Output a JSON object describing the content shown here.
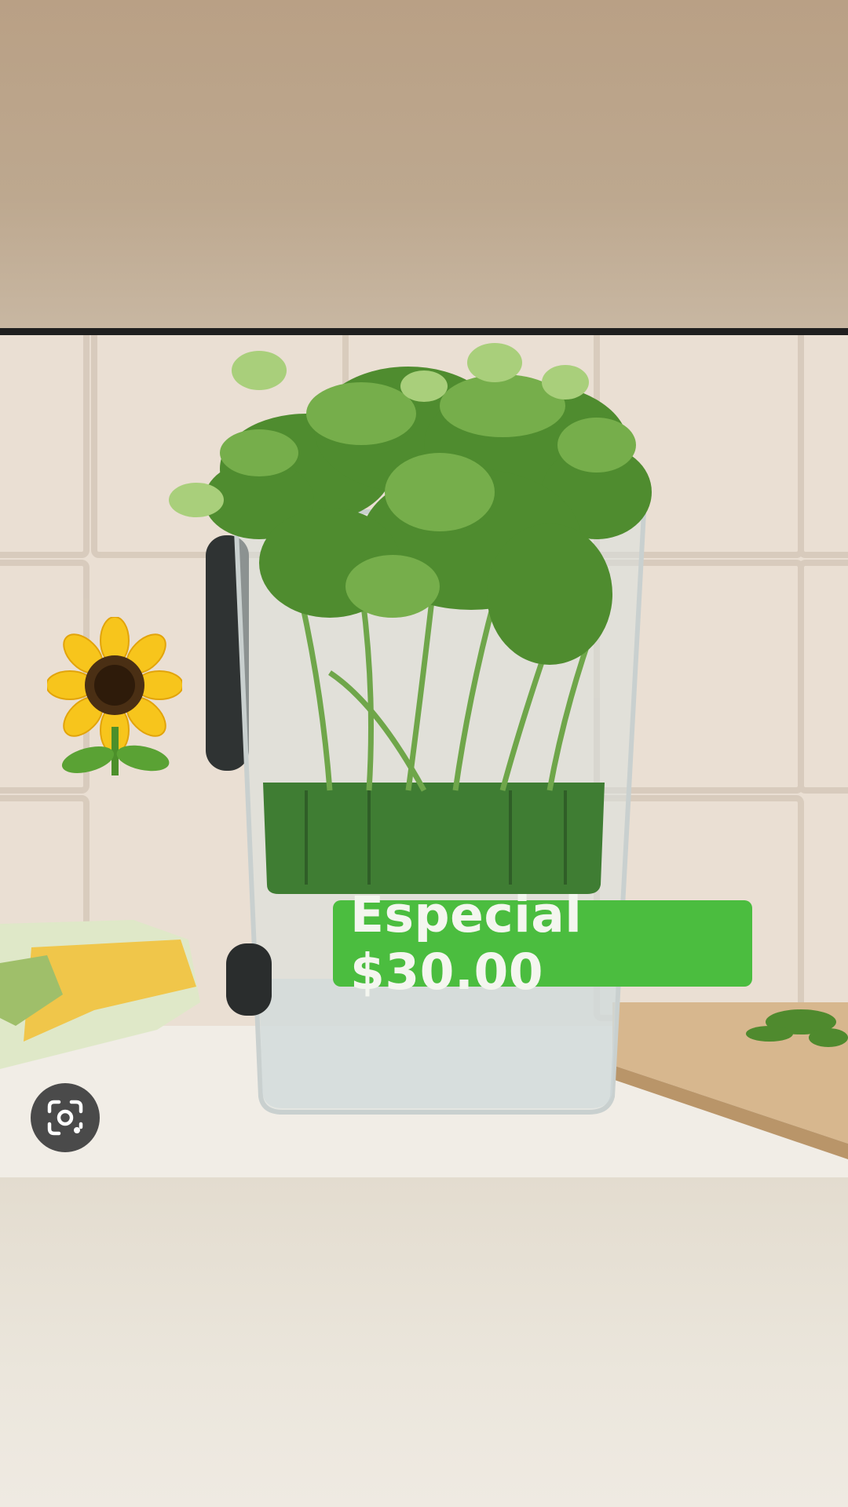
{
  "price_tag": {
    "text": "Especial $30.00"
  },
  "icons": {
    "lens": "google-lens-icon",
    "sticker": "sunflower-icon"
  },
  "colors": {
    "top_band": "#bda88f",
    "divider": "#1f1f1f",
    "price_tag_bg": "#4bbd3f",
    "price_tag_text": "#f4f6ef",
    "lens_button_bg": "#4a4a4a"
  }
}
